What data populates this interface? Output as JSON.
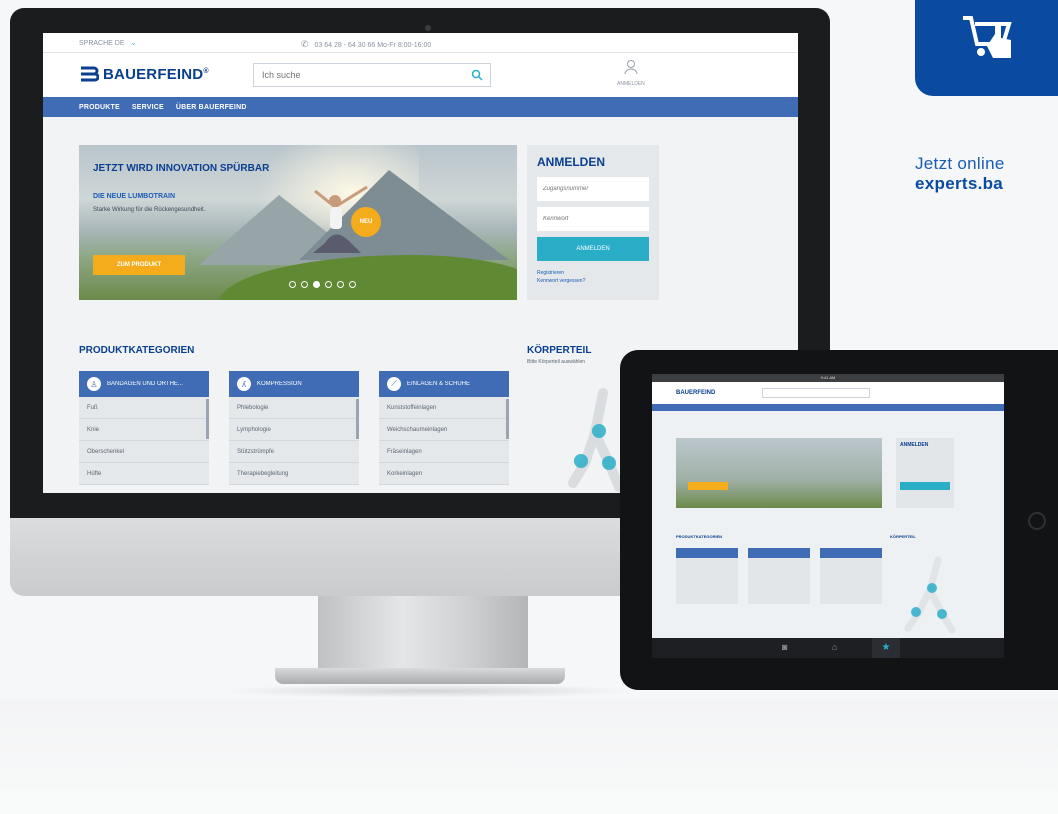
{
  "promo": {
    "line1": "Jetzt online",
    "line2": "experts.ba"
  },
  "desktop": {
    "topbar": {
      "language": "SPRACHE DE",
      "hotline": "03 64 28 - 64 30 66  Mo-Fr 8:00-16:00"
    },
    "header": {
      "logo": "BAUERFEIND",
      "logo_mark": "®",
      "search_placeholder": "Ich suche",
      "account_label": "ANMELDEN"
    },
    "nav": {
      "items": [
        "PRODUKTE",
        "SERVICE",
        "ÜBER BAUERFEIND"
      ]
    },
    "hero": {
      "title": "JETZT WIRD INNOVATION SPÜRBAR",
      "subtitle": "DIE NEUE LUMBOTRAIN",
      "text": "Starke Wirkung für die Rückengesundheit.",
      "button": "ZUM PRODUKT",
      "badge": "NEU",
      "slides": 6,
      "active_slide": 3
    },
    "login": {
      "title": "ANMELDEN",
      "user_placeholder": "Zugangsnummer",
      "pass_placeholder": "Kennwort",
      "button": "ANMELDEN",
      "link_register": "Registrieren",
      "link_forgot": "Kennwort vergessen?"
    },
    "categories": {
      "heading": "PRODUKTKATEGORIEN",
      "columns": [
        {
          "title": "BANDAGEN UND ORTHE...",
          "icon": "body-icon",
          "items": [
            "Fuß",
            "Knie",
            "Oberschenkel",
            "Hüfte"
          ]
        },
        {
          "title": "KOMPRESSION",
          "icon": "leg-icon",
          "items": [
            "Phlebologie",
            "Lymphologie",
            "Stützstrümpfe",
            "Therapiebegleitung"
          ]
        },
        {
          "title": "EINLAGEN & SCHUHE",
          "icon": "insole-icon",
          "items": [
            "Kunststoffeinlagen",
            "Weichschaumeinlagen",
            "Fräseinlagen",
            "Korkeinlagen"
          ]
        }
      ]
    },
    "bodypart": {
      "title": "KÖRPERTEIL",
      "subtitle": "Bitte Körperteil auswählen"
    }
  },
  "tablet": {
    "status": "9:41 AM",
    "logo": "BAUERFEIND",
    "login_title": "ANMELDEN",
    "categories_heading": "PRODUKTKATEGORIEN",
    "bodypart_title": "KÖRPERTEIL",
    "dock": [
      "camera-icon",
      "home-icon",
      "star-icon"
    ]
  },
  "colors": {
    "brand_blue": "#0a3f8f",
    "nav_blue": "#3f6cb4",
    "accent_cyan": "#2aaec8",
    "accent_orange": "#f4ab1c"
  }
}
